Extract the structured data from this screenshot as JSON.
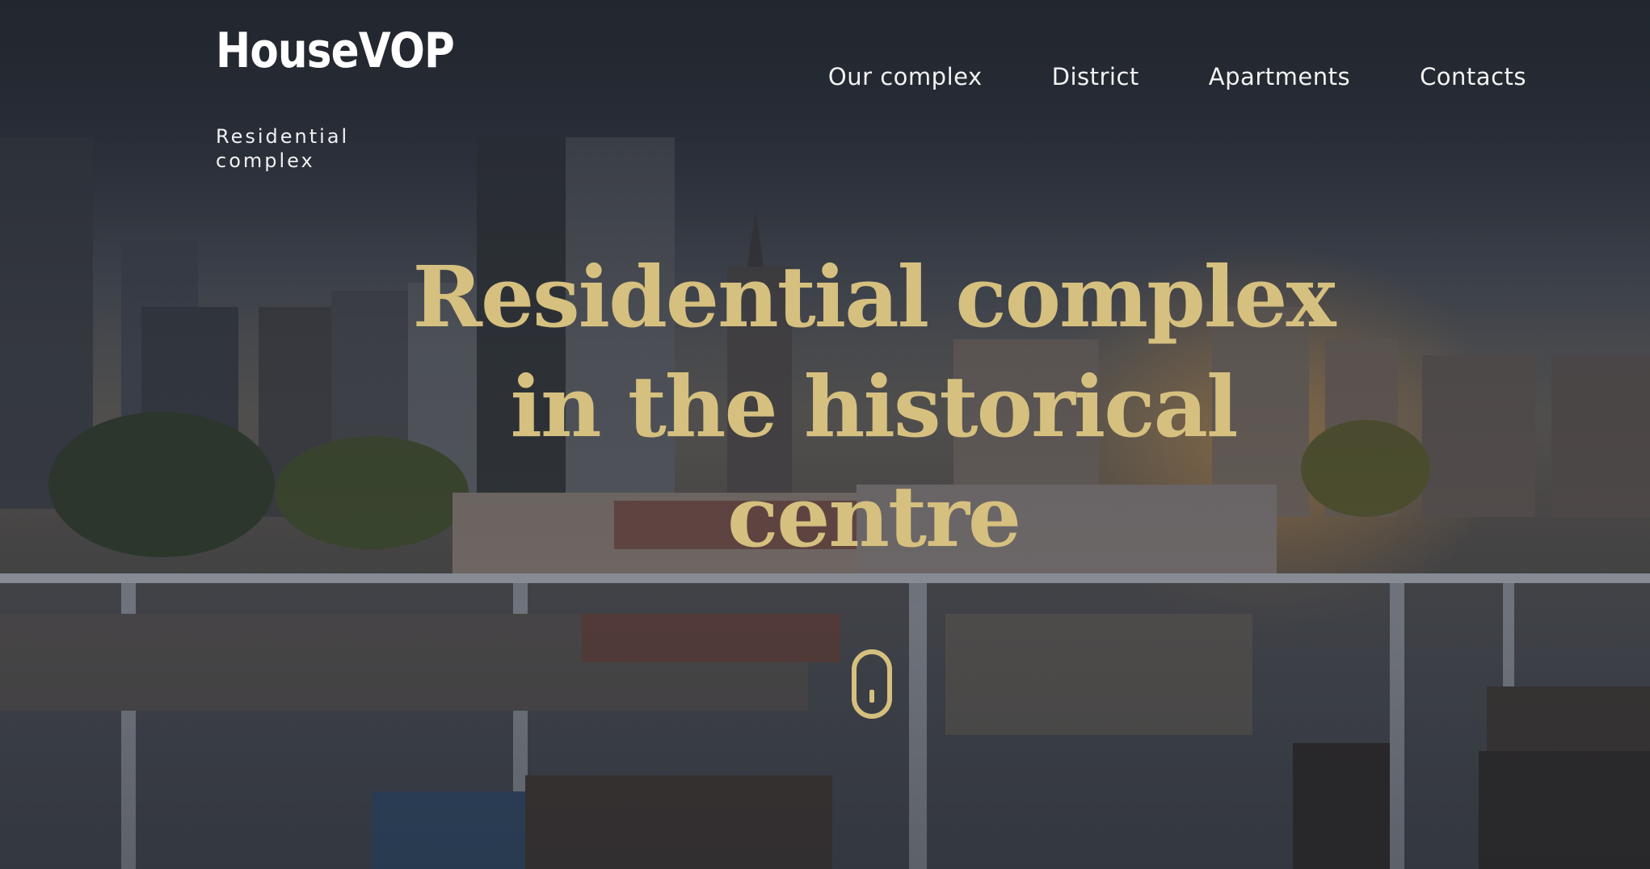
{
  "brand": {
    "logo_text": "HouseVOP",
    "tagline": "Residential complex"
  },
  "nav": {
    "items": [
      {
        "label": "Our complex"
      },
      {
        "label": "District"
      },
      {
        "label": "Apartments"
      },
      {
        "label": "Contacts"
      }
    ]
  },
  "hero": {
    "headline": "Residential complex in the historical centre",
    "scroll_icon": "mouse-scroll-icon",
    "accent_color": "#d6c07f",
    "background_image": "city-skyline-rooftop-terrace-image"
  }
}
